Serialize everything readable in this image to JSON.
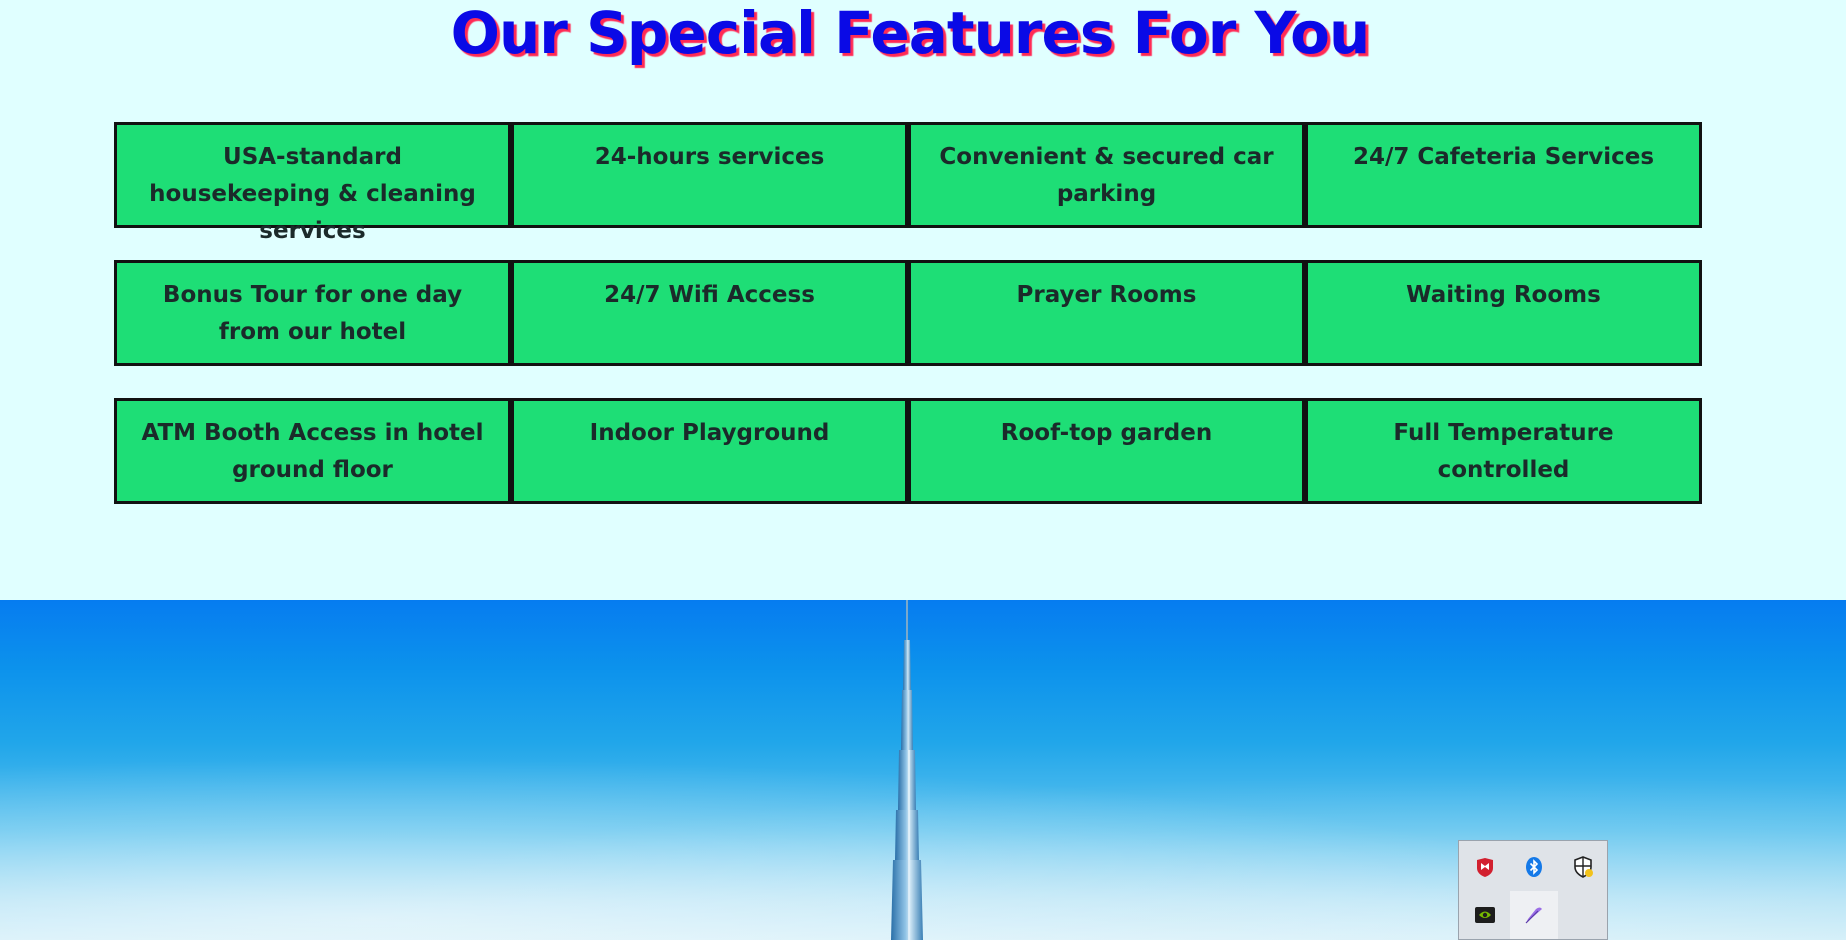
{
  "page": {
    "title": "Our Special Features For You"
  },
  "features": {
    "rows": [
      [
        "USA-standard housekeeping & cleaning services",
        "24-hours services",
        "Convenient & secured car parking",
        "24/7 Cafeteria Services"
      ],
      [
        "Bonus Tour for one day from our hotel",
        "24/7 Wifi Access",
        "Prayer Rooms",
        "Waiting Rooms"
      ],
      [
        "ATM Booth Access in hotel ground floor",
        "Indoor Playground",
        "Roof-top garden",
        "Full Temperature controlled"
      ]
    ]
  },
  "hero": {
    "image": "burj-khalifa-skyline"
  },
  "system_tray": {
    "icons": [
      "mcafee-shield-icon",
      "bluetooth-icon",
      "windows-security-icon",
      "nvidia-icon",
      "pen-feather-icon"
    ]
  },
  "colors": {
    "page_background": "#e0ffff",
    "title_text": "#0a0ae6",
    "title_shadow": "#ff2a55",
    "feature_cell": "#1ede76",
    "feature_border": "#111111",
    "sky_top": "#067cf0"
  }
}
